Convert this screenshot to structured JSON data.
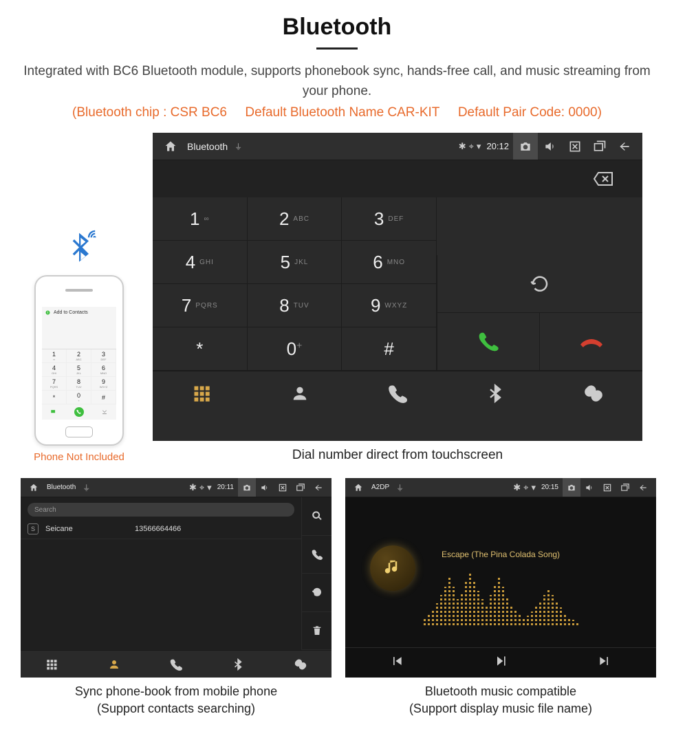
{
  "heading": "Bluetooth",
  "description": "Integrated with BC6 Bluetooth module, supports phonebook sync, hands-free call, and music streaming from your phone.",
  "spec_chip": "(Bluetooth chip : CSR BC6",
  "spec_name": "Default Bluetooth Name CAR-KIT",
  "spec_code": "Default Pair Code: 0000)",
  "phone_note": "Phone Not Included",
  "phone_add_contacts": "Add to Contacts",
  "main_caption": "Dial number direct from touchscreen",
  "main": {
    "title": "Bluetooth",
    "time": "20:12",
    "keys": [
      {
        "d": "1",
        "l": "∞"
      },
      {
        "d": "2",
        "l": "ABC"
      },
      {
        "d": "3",
        "l": "DEF"
      },
      {
        "d": "4",
        "l": "GHI"
      },
      {
        "d": "5",
        "l": "JKL"
      },
      {
        "d": "6",
        "l": "MNO"
      },
      {
        "d": "7",
        "l": "PQRS"
      },
      {
        "d": "8",
        "l": "TUV"
      },
      {
        "d": "9",
        "l": "WXYZ"
      },
      {
        "d": "*",
        "l": ""
      },
      {
        "d": "0",
        "l": "+",
        "sup": true
      },
      {
        "d": "#",
        "l": ""
      }
    ]
  },
  "contacts": {
    "title": "Bluetooth",
    "time": "20:11",
    "search_placeholder": "Search",
    "rows": [
      {
        "initial": "S",
        "name": "Seicane",
        "number": "13566664466"
      }
    ],
    "caption_line1": "Sync phone-book from mobile phone",
    "caption_line2": "(Support contacts searching)"
  },
  "a2dp": {
    "title": "A2DP",
    "time": "20:15",
    "track": "Escape (The Pina Colada Song)",
    "caption_line1": "Bluetooth music compatible",
    "caption_line2": "(Support display music file name)"
  }
}
